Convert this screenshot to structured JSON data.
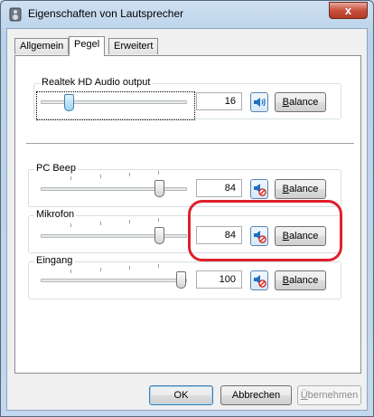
{
  "window": {
    "title": "Eigenschaften von Lautsprecher",
    "close_glyph": "x"
  },
  "tabs": [
    {
      "label": "Allgemein",
      "active": false
    },
    {
      "label": "Pegel",
      "active": true
    },
    {
      "label": "Erweitert",
      "active": false
    }
  ],
  "channels": [
    {
      "label": "Realtek HD Audio output",
      "value": "16",
      "level_fraction": 0.16,
      "muted": false,
      "balance_label": "Balance",
      "balance_mnemonic": "B",
      "balance_rest": "alance"
    },
    {
      "label": "PC Beep",
      "value": "84",
      "level_fraction": 0.84,
      "muted": true,
      "balance_label": "Balance",
      "balance_mnemonic": "B",
      "balance_rest": "alance"
    },
    {
      "label": "Mikrofon",
      "value": "84",
      "level_fraction": 0.84,
      "muted": true,
      "balance_label": "Balance",
      "balance_mnemonic": "B",
      "balance_rest": "alance"
    },
    {
      "label": "Eingang",
      "value": "100",
      "level_fraction": 1.0,
      "muted": true,
      "balance_label": "Balance",
      "balance_mnemonic": "B",
      "balance_rest": "alance"
    }
  ],
  "footer": {
    "ok": "OK",
    "cancel": "Abbrechen",
    "apply_mnemonic": "Ü",
    "apply_rest": "bernehmen"
  },
  "colors": {
    "annotation": "#e0202b",
    "speaker_icon": "#1f6fc4",
    "mute_badge": "#d7261e"
  },
  "icons": {
    "title": "speaker-icon",
    "unmuted": "speaker-sound-icon",
    "muted": "speaker-muted-icon"
  }
}
